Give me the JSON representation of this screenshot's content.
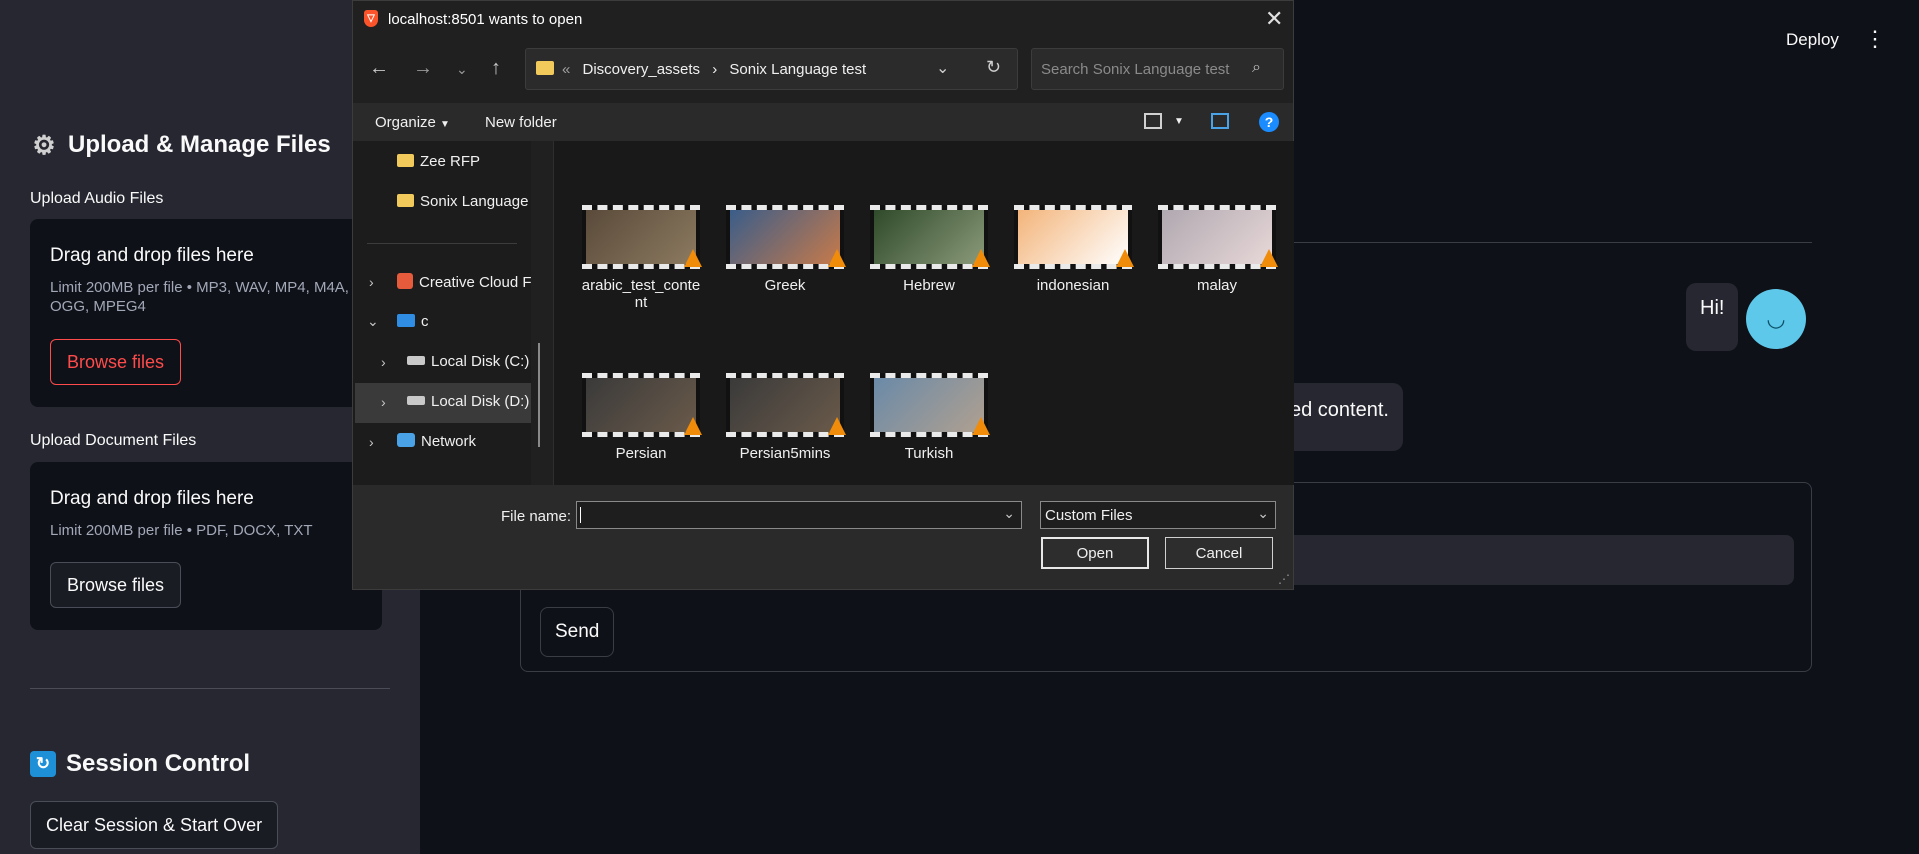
{
  "sidebar": {
    "upload_header": "Upload & Manage Files",
    "audio_label": "Upload Audio Files",
    "audio_uploader": {
      "title": "Drag and drop files here",
      "limit": "Limit 200MB per file • MP3, WAV, MP4, M4A, OGG, MPEG4",
      "button": "Browse files"
    },
    "doc_label": "Upload Document Files",
    "doc_uploader": {
      "title": "Drag and drop files here",
      "limit": "Limit 200MB per file • PDF, DOCX, TXT",
      "button": "Browse files"
    },
    "session_header": "Session Control",
    "clear_button": "Clear Session & Start Over"
  },
  "topbar": {
    "deploy": "Deploy"
  },
  "chat": {
    "user_message": "Hi!",
    "bot_message_visible": "ed content.",
    "send_button": "Send"
  },
  "dialog": {
    "title": "localhost:8501 wants to open",
    "breadcrumb": [
      "«",
      "Discovery_assets",
      "›",
      "Sonix Language test"
    ],
    "search_placeholder": "Search Sonix Language test",
    "organize": "Organize",
    "new_folder": "New folder",
    "tree": {
      "zee": "Zee RFP",
      "sonix": "Sonix Language",
      "creative": "Creative Cloud F",
      "c": "c",
      "local_c": "Local Disk (C:)",
      "local_d": "Local Disk (D:)",
      "network": "Network"
    },
    "files": [
      {
        "name": "arabic_test_content",
        "colors": [
          "#5a4a3a",
          "#8c7a60"
        ]
      },
      {
        "name": "Greek",
        "colors": [
          "#3a5d8a",
          "#c77a4a"
        ]
      },
      {
        "name": "Hebrew",
        "colors": [
          "#2f4a2a",
          "#8a9a7a"
        ]
      },
      {
        "name": "indonesian",
        "colors": [
          "#f3b47a",
          "#ffffff"
        ]
      },
      {
        "name": "malay",
        "colors": [
          "#b0a8b0",
          "#e8d8d8"
        ]
      },
      {
        "name": "Persian",
        "colors": [
          "#3a3a3a",
          "#6a5a4a"
        ]
      },
      {
        "name": "Persian5mins",
        "colors": [
          "#3a3a3a",
          "#6a5a4a"
        ]
      },
      {
        "name": "Turkish",
        "colors": [
          "#6a8aa8",
          "#b0a090"
        ]
      }
    ],
    "file_name_label": "File name:",
    "file_name_value": "",
    "file_type": "Custom Files",
    "open": "Open",
    "cancel": "Cancel"
  }
}
